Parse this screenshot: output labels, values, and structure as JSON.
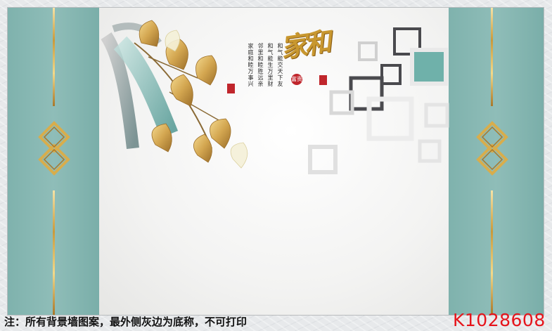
{
  "artwork": {
    "calligraphy_title": "家和",
    "seal_text": "富贵",
    "poem_lines": [
      "和气能交天下友",
      "和气能生万里财",
      "邻里和睦胜远亲",
      "家庭和睦万事兴"
    ]
  },
  "footer": {
    "note": "注：所有背景墙图案，最外侧灰边为底称，不可打印",
    "code": "K1028608"
  },
  "colors": {
    "teal_panel": "#86b6b1",
    "gold": "#c99a3c",
    "code_red": "#e6141b"
  }
}
